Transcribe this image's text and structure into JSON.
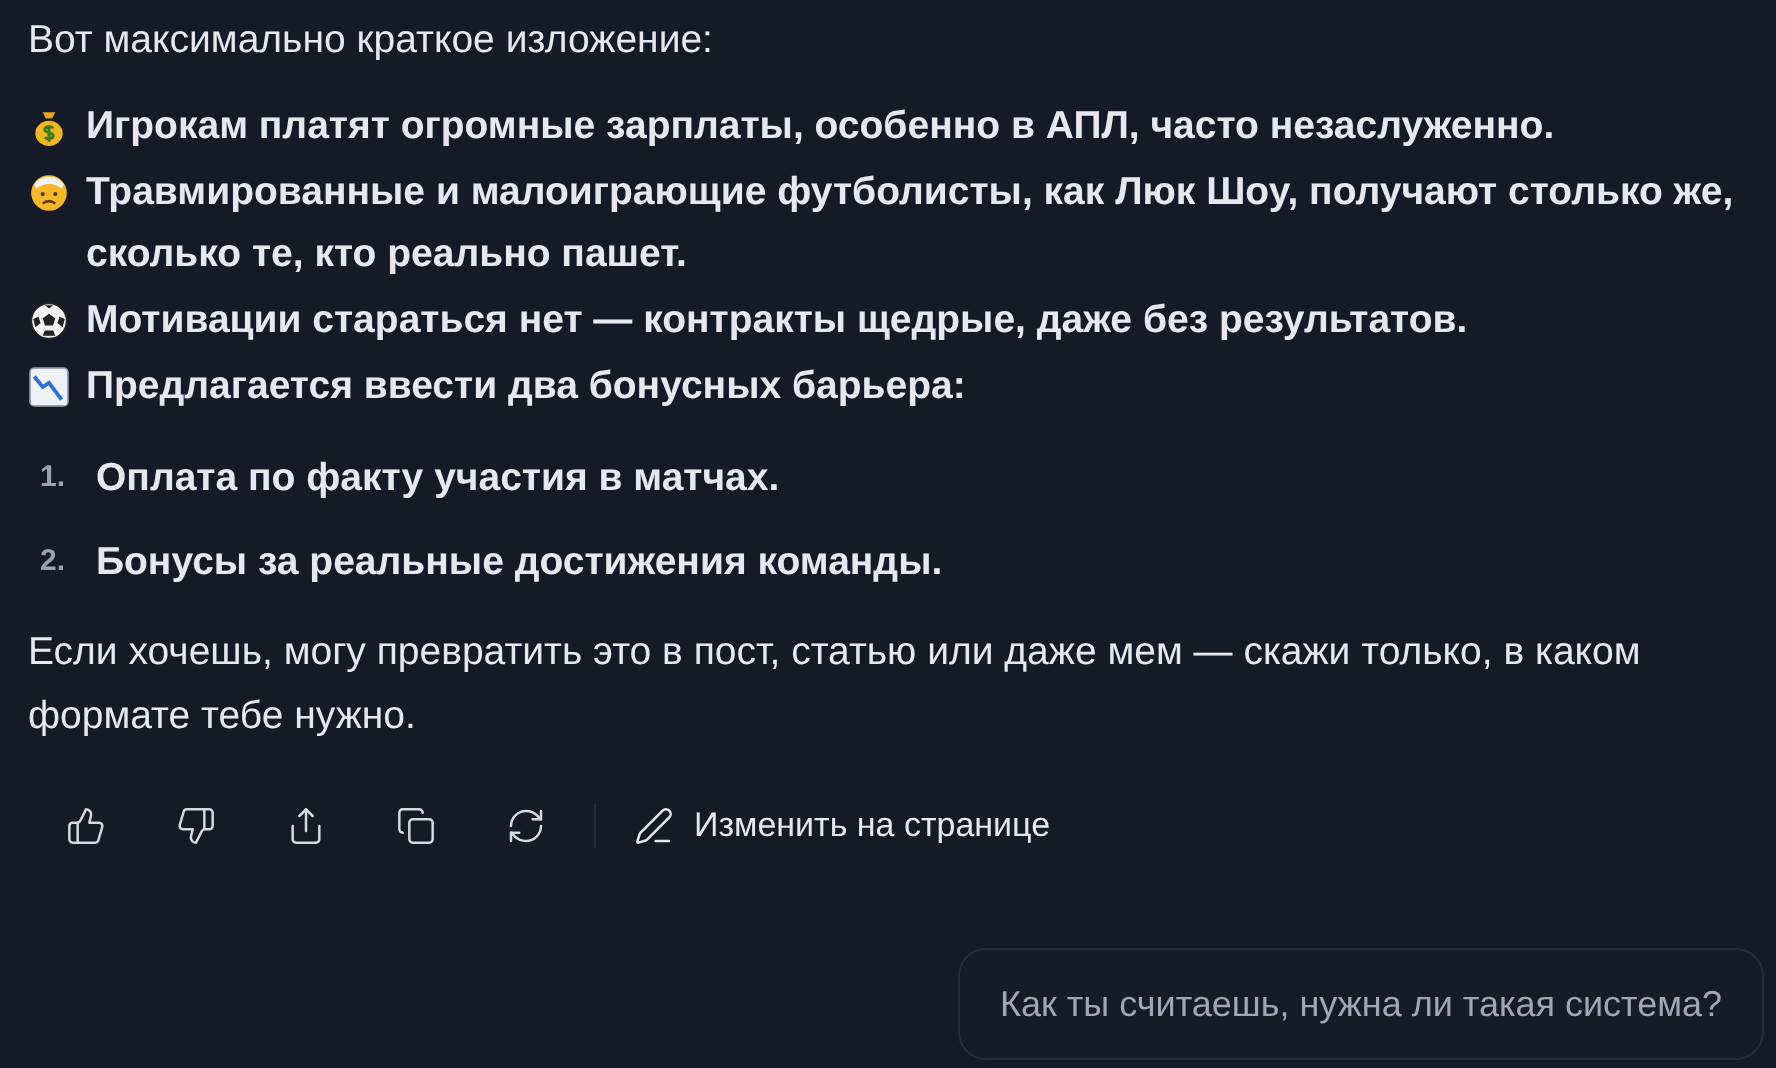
{
  "intro": "Вот максимально краткое изложение:",
  "bullets": [
    {
      "kind": "money",
      "text": "Игрокам платят огромные зарплаты, особенно в АПЛ, часто незаслуженно."
    },
    {
      "kind": "injured",
      "text": "Травмированные и малоиграющие футболисты, как Люк Шоу, получают столько же, сколько те, кто реально пашет."
    },
    {
      "kind": "ball",
      "text": "Мотивации стараться нет — контракты щедрые, даже без результатов."
    },
    {
      "kind": "chart",
      "text": "Предлагается ввести два бонусных барьера:"
    }
  ],
  "steps": [
    {
      "number": "1.",
      "text": "Оплата по факту участия в матчах."
    },
    {
      "number": "2.",
      "text": "Бонусы за реальные достижения команды."
    }
  ],
  "closing": "Если хочешь, могу превратить это в пост, статью или даже мем — скажи только, в каком формате тебе нужно.",
  "actions": [
    {
      "kind": "like"
    },
    {
      "kind": "dislike"
    },
    {
      "kind": "share"
    },
    {
      "kind": "copy"
    },
    {
      "kind": "regenerate"
    }
  ],
  "edit_label": "Изменить на странице",
  "suggestion": "Как ты считаешь, нужна ли такая система?"
}
